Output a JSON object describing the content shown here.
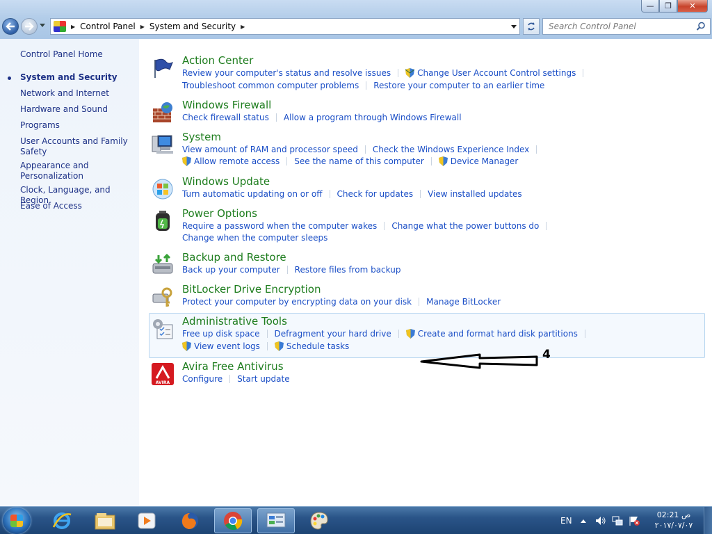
{
  "window": {
    "minimize_glyph": "—",
    "maximize_glyph": "❐",
    "close_glyph": "✕"
  },
  "address": {
    "crumbs": [
      "Control Panel",
      "System and Security"
    ],
    "search_placeholder": "Search Control Panel"
  },
  "sidebar": {
    "home": "Control Panel Home",
    "items": [
      {
        "label": "System and Security",
        "current": true
      },
      {
        "label": "Network and Internet"
      },
      {
        "label": "Hardware and Sound"
      },
      {
        "label": "Programs"
      },
      {
        "label": "User Accounts and Family Safety"
      },
      {
        "label": "Appearance and Personalization"
      },
      {
        "label": "Clock, Language, and Region"
      },
      {
        "label": "Ease of Access"
      }
    ]
  },
  "categories": {
    "action_center": {
      "title": "Action Center",
      "links": [
        "Review your computer's status and resolve issues",
        "Change User Account Control settings",
        "Troubleshoot common computer problems",
        "Restore your computer to an earlier time"
      ]
    },
    "firewall": {
      "title": "Windows Firewall",
      "links": [
        "Check firewall status",
        "Allow a program through Windows Firewall"
      ]
    },
    "system": {
      "title": "System",
      "links": [
        "View amount of RAM and processor speed",
        "Check the Windows Experience Index",
        "Allow remote access",
        "See the name of this computer",
        "Device Manager"
      ]
    },
    "update": {
      "title": "Windows Update",
      "links": [
        "Turn automatic updating on or off",
        "Check for updates",
        "View installed updates"
      ]
    },
    "power": {
      "title": "Power Options",
      "links": [
        "Require a password when the computer wakes",
        "Change what the power buttons do",
        "Change when the computer sleeps"
      ]
    },
    "backup": {
      "title": "Backup and Restore",
      "links": [
        "Back up your computer",
        "Restore files from backup"
      ]
    },
    "bitlocker": {
      "title": "BitLocker Drive Encryption",
      "links": [
        "Protect your computer by encrypting data on your disk",
        "Manage BitLocker"
      ]
    },
    "admin": {
      "title": "Administrative Tools",
      "links": [
        "Free up disk space",
        "Defragment your hard drive",
        "Create and format hard disk partitions",
        "View event logs",
        "Schedule tasks"
      ]
    },
    "avira": {
      "title": "Avira Free Antivirus",
      "links": [
        "Configure",
        "Start update"
      ],
      "logo_text": "AVIRA"
    }
  },
  "annotation": {
    "number": "4"
  },
  "taskbar": {
    "language": "EN",
    "time": "02:21 ص",
    "date": "٢٠١٧/٠٧/٠٧"
  },
  "colors": {
    "link": "#1a4ec6",
    "category_title": "#1e7d1e",
    "nav_text": "#1e3287",
    "taskbar": "#2a5488"
  }
}
